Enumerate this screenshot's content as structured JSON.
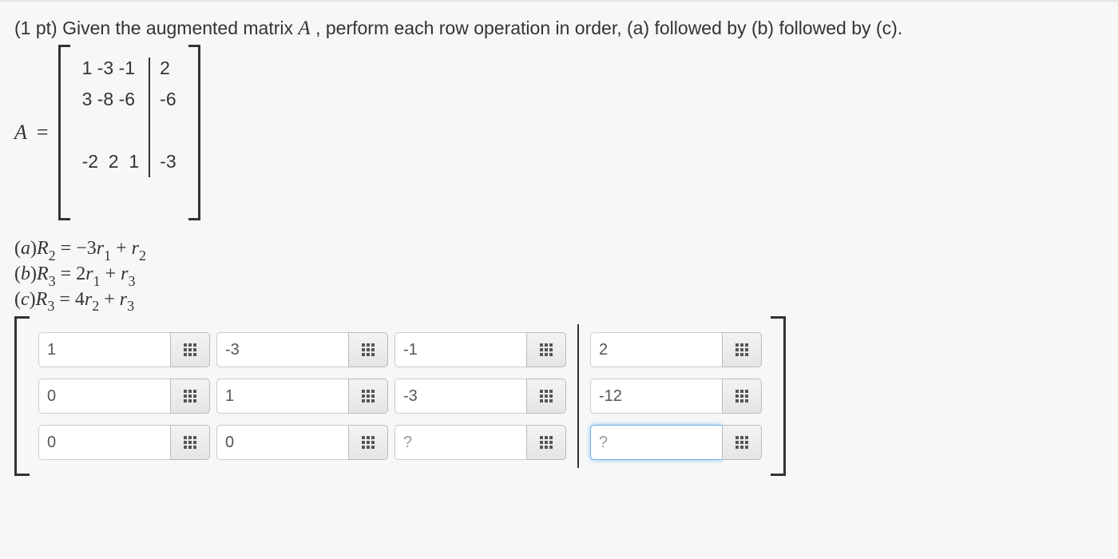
{
  "prompt": {
    "points_label": "(1 pt) ",
    "text_before": "Given the augmented matrix ",
    "var": "A",
    "text_after": " , perform each row operation in order, (a) followed by (b) followed by (c)."
  },
  "matrix_label": "A",
  "matrix": {
    "row1_left": "1 -3 -1",
    "row1_right": "2",
    "row2_left": "3 -8 -6",
    "row2_right": "-6",
    "row3_left": "-2  2  1",
    "row3_right": "-3"
  },
  "operations": {
    "a": "(a)R₂ = −3r₁ + r₂",
    "b": "(b)R₃ = 2r₁ + r₃",
    "c": "(c)R₃ = 4r₂ + r₃"
  },
  "answers": {
    "r1c1": "1",
    "r1c2": "-3",
    "r1c3": "-1",
    "r1c4": "2",
    "r2c1": "0",
    "r2c2": "1",
    "r2c3": "-3",
    "r2c4": "-12",
    "r3c1": "0",
    "r3c2": "0",
    "r3c3": "",
    "r3c4": ""
  },
  "placeholder": "?"
}
